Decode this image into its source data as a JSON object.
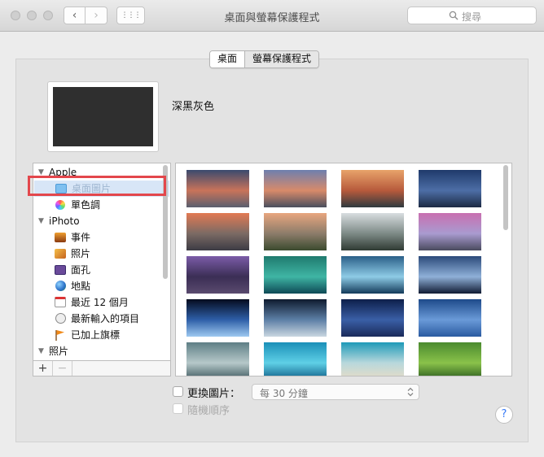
{
  "window": {
    "title": "桌面與螢幕保護程式",
    "search_placeholder": "搜尋",
    "back_glyph": "‹",
    "forward_glyph": "›",
    "grid_glyph": "⋮⋮⋮"
  },
  "tabs": [
    {
      "label": "桌面",
      "selected": true
    },
    {
      "label": "螢幕保護程式",
      "selected": false
    }
  ],
  "current_wallpaper": {
    "name": "深黑灰色"
  },
  "sidebar": {
    "groups": [
      {
        "label": "Apple",
        "items": [
          {
            "label": "桌面圖片",
            "icon": "folder-icon",
            "selected": true
          },
          {
            "label": "單色調",
            "icon": "color-wheel-icon"
          }
        ]
      },
      {
        "label": "iPhoto",
        "items": [
          {
            "label": "事件",
            "icon": "events-icon"
          },
          {
            "label": "照片",
            "icon": "photos-icon"
          },
          {
            "label": "面孔",
            "icon": "faces-icon"
          },
          {
            "label": "地點",
            "icon": "globe-icon"
          },
          {
            "label": "最近 12 個月",
            "icon": "calendar-icon"
          },
          {
            "label": "最新輸入的項目",
            "icon": "import-icon"
          },
          {
            "label": "已加上旗標",
            "icon": "flag-icon"
          }
        ]
      },
      {
        "label": "照片",
        "items": []
      }
    ],
    "add_label": "+",
    "remove_label": "−"
  },
  "gallery": {
    "thumbnails": [
      {
        "name": "sierra",
        "colors": [
          "#3a4a6e",
          "#c9735a",
          "#5a5f6e"
        ]
      },
      {
        "name": "sierra-2",
        "colors": [
          "#6e7fae",
          "#d88a6a",
          "#4a4f5e"
        ]
      },
      {
        "name": "el-capitan",
        "colors": [
          "#e8a36a",
          "#b75a3c",
          "#2e3a3f"
        ]
      },
      {
        "name": "el-capitan-2",
        "colors": [
          "#1f3a6b",
          "#4d6ea6",
          "#1c2a44"
        ]
      },
      {
        "name": "yosemite",
        "colors": [
          "#e27a53",
          "#7b6a64",
          "#3c3b44"
        ]
      },
      {
        "name": "yosemite-2",
        "colors": [
          "#e8a67f",
          "#8c7c6a",
          "#3b4a2e"
        ]
      },
      {
        "name": "yosemite-3",
        "colors": [
          "#d8dde0",
          "#7d8a86",
          "#2f3a33"
        ]
      },
      {
        "name": "yosemite-4",
        "colors": [
          "#c96fb0",
          "#a99bd0",
          "#4a4a5e"
        ]
      },
      {
        "name": "lake",
        "colors": [
          "#7b5ca8",
          "#3b2e55",
          "#5a4a6e"
        ]
      },
      {
        "name": "mavericks",
        "colors": [
          "#1f7a6e",
          "#3fb5a4",
          "#0e4a56"
        ]
      },
      {
        "name": "wave",
        "colors": [
          "#2a5f88",
          "#8ecbe6",
          "#133a5a"
        ]
      },
      {
        "name": "galaxy",
        "colors": [
          "#2b4a7a",
          "#8fb0d8",
          "#111b33"
        ]
      },
      {
        "name": "earth-horizon",
        "colors": [
          "#050b1e",
          "#2e5fa8",
          "#9ec9f0"
        ]
      },
      {
        "name": "earth-2",
        "colors": [
          "#0e1a2e",
          "#5d7fa6",
          "#c9d6e0"
        ]
      },
      {
        "name": "milky-way",
        "colors": [
          "#0d1f4a",
          "#3a5fa6",
          "#1a2a5a"
        ]
      },
      {
        "name": "moon-sky",
        "colors": [
          "#1e4a8a",
          "#6a9ad8",
          "#2a5aa0"
        ]
      },
      {
        "name": "clouds",
        "colors": [
          "#5e7f86",
          "#b6c8c9",
          "#3f5a60"
        ]
      },
      {
        "name": "reef",
        "colors": [
          "#1a8fb8",
          "#5fd0e6",
          "#0f5e88"
        ]
      },
      {
        "name": "beach",
        "colors": [
          "#1e9ab8",
          "#b8d8dc",
          "#e8dcc6"
        ]
      },
      {
        "name": "fields",
        "colors": [
          "#4a8a2e",
          "#8ac24a",
          "#2a5a1e"
        ]
      }
    ]
  },
  "options": {
    "change_picture_label": "更換圖片：",
    "interval_value": "每 30 分鐘",
    "random_order_label": "隨機順序",
    "help_label": "?"
  }
}
